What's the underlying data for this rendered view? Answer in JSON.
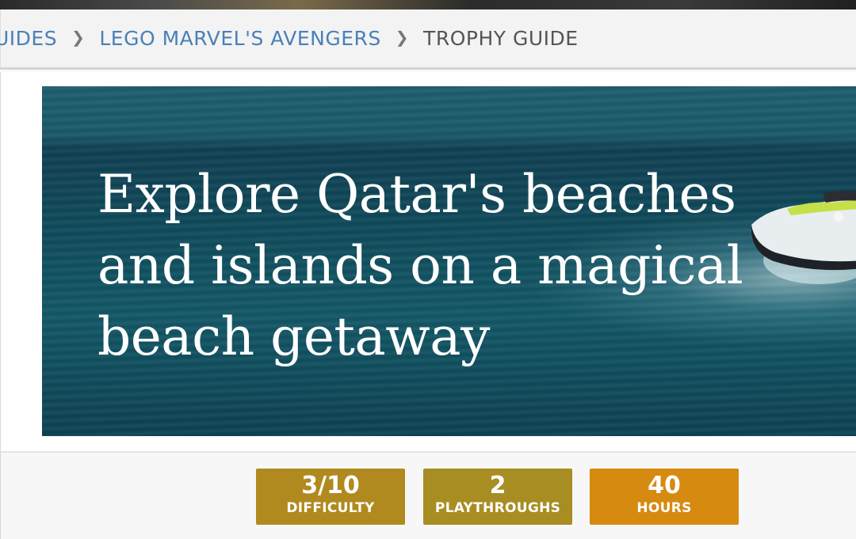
{
  "breadcrumb": {
    "items": [
      "UIDES",
      "LEGO MARVEL'S AVENGERS"
    ],
    "current": "TROPHY GUIDE",
    "separator": "❯"
  },
  "ad": {
    "headline_line1": "Explore Qatar's beaches",
    "headline_line2": "and islands on a magical",
    "headline_line3": "beach getaway"
  },
  "stats": {
    "difficulty": {
      "value": "3/10",
      "label": "DIFFICULTY",
      "color": "#b08a1e"
    },
    "playthroughs": {
      "value": "2",
      "label": "PLAYTHROUGHS",
      "color": "#a88d22"
    },
    "hours": {
      "value": "40",
      "label": "HOURS",
      "color": "#d68a0f"
    }
  },
  "colors": {
    "link": "#4a80b8",
    "current_crumb": "#555555"
  }
}
